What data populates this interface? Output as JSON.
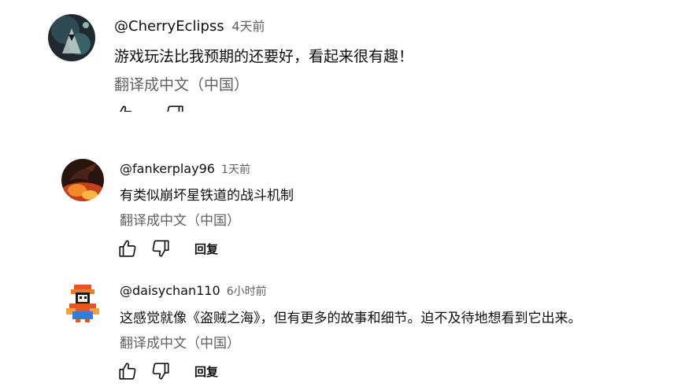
{
  "comments": [
    {
      "author": "@CherryEclipss",
      "time": "4天前",
      "text": "游戏玩法比我预期的还要好，看起来很有趣！",
      "translate_label": "翻译成中文（中国）",
      "avatar_icon": "dark-character-avatar"
    },
    {
      "author": "@fankerplay96",
      "time": "1天前",
      "text": "有类似崩坏星铁道的战斗机制",
      "translate_label": "翻译成中文（中国）",
      "avatar_icon": "dragon-fire-avatar",
      "reply_label": "回复"
    },
    {
      "author": "@daisychan110",
      "time": "6小时前",
      "text": "这感觉就像《盗贼之海》，但有更多的故事和细节。迫不及待地想看到它出来。",
      "translate_label": "翻译成中文（中国）",
      "avatar_icon": "pixel-character-avatar",
      "reply_label": "回复"
    }
  ],
  "icons": {
    "like": "thumbs-up-icon",
    "dislike": "thumbs-down-icon"
  }
}
